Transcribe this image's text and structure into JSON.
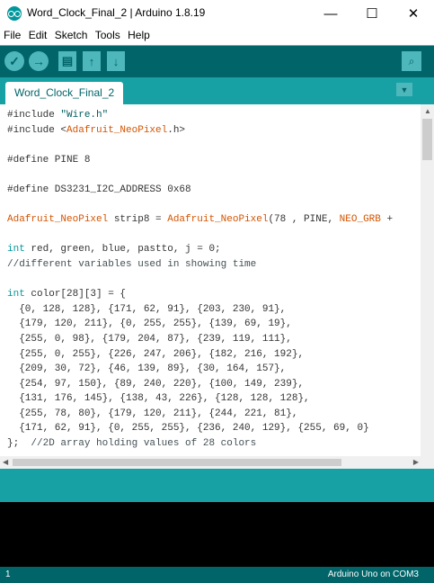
{
  "window": {
    "title": "Word_Clock_Final_2 | Arduino 1.8.19",
    "minimize": "—",
    "maximize": "☐",
    "close": "✕"
  },
  "menu": [
    "File",
    "Edit",
    "Sketch",
    "Tools",
    "Help"
  ],
  "toolbar": {
    "verify": "✓",
    "upload": "→",
    "new": "▤",
    "open": "↑",
    "save": "↓",
    "serial_monitor": "⌕"
  },
  "tab": {
    "name": "Word_Clock_Final_2",
    "menu": "▼"
  },
  "code": {
    "lines": [
      [
        {
          "t": "#include "
        },
        {
          "t": "\"Wire.h\"",
          "c": "#005c5f"
        }
      ],
      [
        {
          "t": "#include <"
        },
        {
          "t": "Adafruit_NeoPixel",
          "c": "#d35400"
        },
        {
          "t": ".h>"
        }
      ],
      [],
      [
        {
          "t": "#define PINE 8"
        }
      ],
      [],
      [
        {
          "t": "#define DS3231_I2C_ADDRESS 0x68"
        }
      ],
      [],
      [
        {
          "t": "Adafruit_NeoPixel",
          "c": "#d35400"
        },
        {
          "t": " strip8 = "
        },
        {
          "t": "Adafruit_NeoPixel",
          "c": "#d35400"
        },
        {
          "t": "(78 , PINE, "
        },
        {
          "t": "NEO_GRB",
          "c": "#d35400"
        },
        {
          "t": " +"
        }
      ],
      [],
      [
        {
          "t": "int",
          "c": "#00979c"
        },
        {
          "t": " red, green, blue, pastto, j = 0;"
        }
      ],
      [
        {
          "t": "//different variables used in showing time",
          "c": "#434f54"
        }
      ],
      [],
      [
        {
          "t": "int",
          "c": "#00979c"
        },
        {
          "t": " color[28][3] = {"
        }
      ],
      [
        {
          "t": "  {0, 128, 128}, {171, 62, 91}, {203, 230, 91},"
        }
      ],
      [
        {
          "t": "  {179, 120, 211}, {0, 255, 255}, {139, 69, 19},"
        }
      ],
      [
        {
          "t": "  {255, 0, 98}, {179, 204, 87}, {239, 119, 111},"
        }
      ],
      [
        {
          "t": "  {255, 0, 255}, {226, 247, 206}, {182, 216, 192},"
        }
      ],
      [
        {
          "t": "  {209, 30, 72}, {46, 139, 89}, {30, 164, 157},"
        }
      ],
      [
        {
          "t": "  {254, 97, 150}, {89, 240, 220}, {100, 149, 239},"
        }
      ],
      [
        {
          "t": "  {131, 176, 145}, {138, 43, 226}, {128, 128, 128},"
        }
      ],
      [
        {
          "t": "  {255, 78, 80}, {179, 120, 211}, {244, 221, 81},"
        }
      ],
      [
        {
          "t": "  {171, 62, 91}, {0, 255, 255}, {236, 240, 129}, {255, 69, 0}"
        }
      ],
      [
        {
          "t": "};  "
        },
        {
          "t": "//2D array holding values of 28 colors",
          "c": "#434f54"
        }
      ]
    ]
  },
  "footer": {
    "line": "1",
    "board": "Arduino Uno on COM3"
  },
  "colors": {
    "toolbar": "#006468",
    "tab_strip": "#17a1a5",
    "button": "#4db7bb",
    "keyword": "#00979c",
    "library": "#d35400",
    "comment": "#434f54",
    "console": "#000000"
  }
}
